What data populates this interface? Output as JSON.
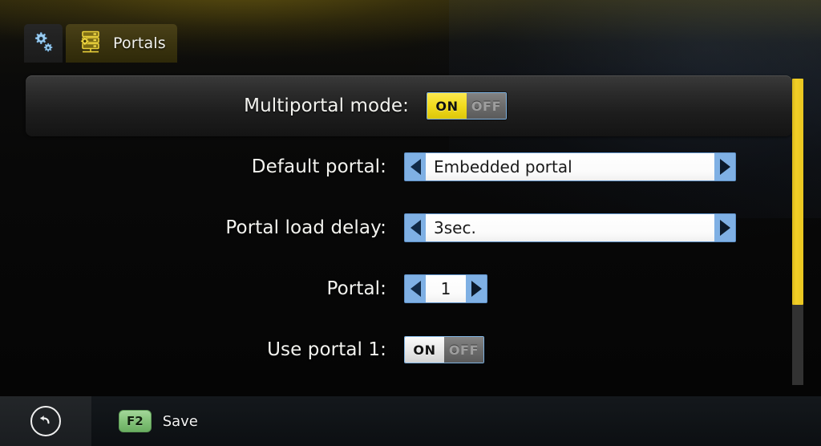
{
  "tabs": [
    {
      "id": "settings",
      "icon": "gears-icon",
      "label": "",
      "active": false
    },
    {
      "id": "portals",
      "icon": "server-rack-gear-icon",
      "label": "Portals",
      "active": true
    }
  ],
  "settings_rows": [
    {
      "name": "multiportal-mode",
      "label": "Multiportal mode:",
      "control": "toggle",
      "on_label": "ON",
      "off_label": "OFF",
      "value": "ON",
      "selected": true
    },
    {
      "name": "default-portal",
      "label": "Default portal:",
      "control": "spinner-wide",
      "value": "Embedded portal",
      "selected": false
    },
    {
      "name": "portal-load-delay",
      "label": "Portal load delay:",
      "control": "spinner-wide",
      "value": "3sec.",
      "selected": false
    },
    {
      "name": "portal-index",
      "label": "Portal:",
      "control": "spinner-narrow",
      "value": "1",
      "selected": false
    },
    {
      "name": "use-portal-1",
      "label": "Use portal 1:",
      "control": "toggle",
      "on_label": "ON",
      "off_label": "OFF",
      "value": "ON",
      "selected": false
    }
  ],
  "scrollbar": {
    "thumb_position_percent": 0,
    "thumb_size_percent": 74
  },
  "bottom_bar": {
    "back_icon": "back-arrow-icon",
    "hints": [
      {
        "key": "F2",
        "label": "Save"
      }
    ]
  },
  "colors": {
    "accent_yellow": "#f2cf26",
    "toggle_on_yellow": "#f2dc20",
    "spinner_blue": "#7fb0e4",
    "key_green": "#82c278",
    "text_primary": "#f3f3ef"
  }
}
